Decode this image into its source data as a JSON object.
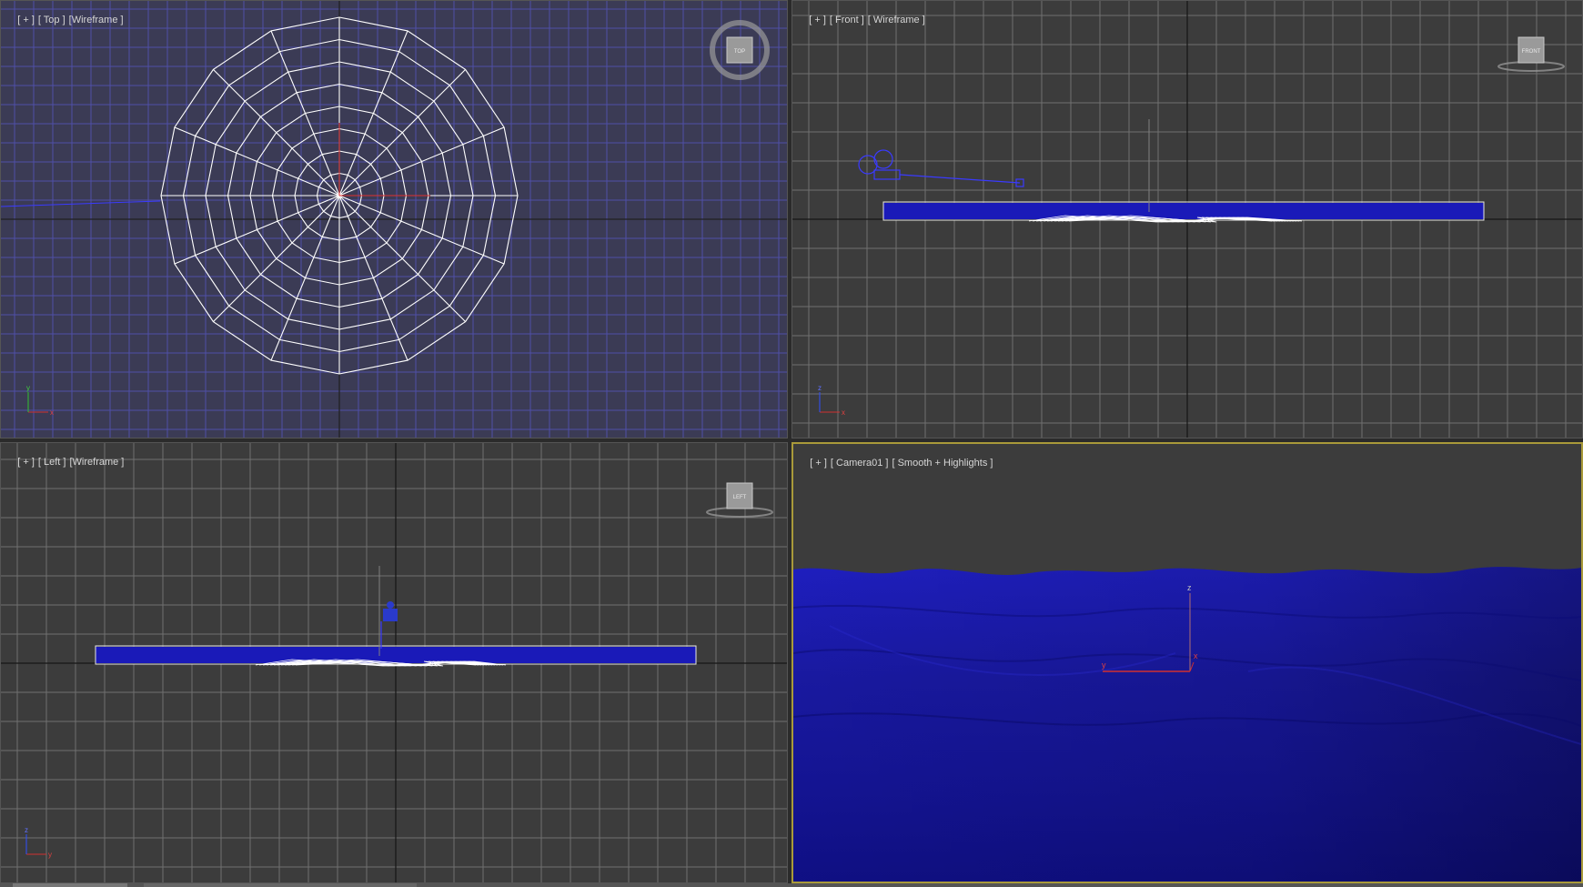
{
  "viewports": {
    "top": {
      "plus": "[ + ]",
      "view": "[ Top ]",
      "shade": "[Wireframe ]",
      "cube_label": "TOP"
    },
    "front": {
      "plus": "[ + ]",
      "view": "[ Front ]",
      "shade": "[ Wireframe ]",
      "cube_label": "FRONT"
    },
    "left": {
      "plus": "[ + ]",
      "view": "[ Left ]",
      "shade": "[Wireframe ]",
      "cube_label": "LEFT"
    },
    "camera": {
      "plus": "[ + ]",
      "view": "[ Camera01 ]",
      "shade": "[ Smooth + Highlights ]"
    }
  },
  "axes": {
    "x": "x",
    "y": "y",
    "z": "z"
  },
  "colors": {
    "viewport_bg": "#3c3c3c",
    "grid": "#6e6e6e",
    "grid_top": "#5a5a9a",
    "water": "#1a1ab0",
    "wire": "#ffffff",
    "active_border": "#a99a3a"
  },
  "icons": {
    "viewcube": "viewcube-icon",
    "axis_tripod": "axis-tripod-icon",
    "gizmo": "transform-gizmo-icon"
  }
}
